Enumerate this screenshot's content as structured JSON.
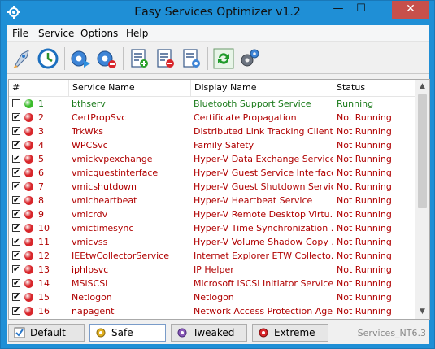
{
  "window": {
    "title": "Easy Services Optimizer v1.2",
    "minimize": "—",
    "maximize": "☐",
    "close": "✕"
  },
  "menu": [
    "File",
    "Service",
    "Options",
    "Help"
  ],
  "toolbar": [
    "rocket-icon",
    "restore-icon",
    "play-service-icon",
    "stop-service-icon",
    "doc-add-icon",
    "doc-remove-icon",
    "doc-settings-icon",
    "refresh-icon",
    "gears-icon"
  ],
  "columns": {
    "num": "#",
    "service": "Service Name",
    "display": "Display Name",
    "status": "Status"
  },
  "colors": {
    "running": "#1a7a1a",
    "stopped": "#b00000",
    "green_dot": "#3cbc2c",
    "red_dot": "#d8262b"
  },
  "rows": [
    {
      "checked": false,
      "state": "green",
      "num": "1",
      "service": "bthserv",
      "display": "Bluetooth Support Service",
      "status": "Running"
    },
    {
      "checked": true,
      "state": "red",
      "num": "2",
      "service": "CertPropSvc",
      "display": "Certificate Propagation",
      "status": "Not Running"
    },
    {
      "checked": true,
      "state": "red",
      "num": "3",
      "service": "TrkWks",
      "display": "Distributed Link Tracking Client",
      "status": "Not Running"
    },
    {
      "checked": true,
      "state": "red",
      "num": "4",
      "service": "WPCSvc",
      "display": "Family Safety",
      "status": "Not Running"
    },
    {
      "checked": true,
      "state": "red",
      "num": "5",
      "service": "vmickvpexchange",
      "display": "Hyper-V Data Exchange Service",
      "status": "Not Running"
    },
    {
      "checked": true,
      "state": "red",
      "num": "6",
      "service": "vmicguestinterface",
      "display": "Hyper-V Guest Service Interface",
      "status": "Not Running"
    },
    {
      "checked": true,
      "state": "red",
      "num": "7",
      "service": "vmicshutdown",
      "display": "Hyper-V Guest Shutdown Service",
      "status": "Not Running"
    },
    {
      "checked": true,
      "state": "red",
      "num": "8",
      "service": "vmicheartbeat",
      "display": "Hyper-V Heartbeat Service",
      "status": "Not Running"
    },
    {
      "checked": true,
      "state": "red",
      "num": "9",
      "service": "vmicrdv",
      "display": "Hyper-V Remote Desktop Virtu...",
      "status": "Not Running"
    },
    {
      "checked": true,
      "state": "red",
      "num": "10",
      "service": "vmictimesync",
      "display": "Hyper-V Time Synchronization ...",
      "status": "Not Running"
    },
    {
      "checked": true,
      "state": "red",
      "num": "11",
      "service": "vmicvss",
      "display": "Hyper-V Volume Shadow Copy ...",
      "status": "Not Running"
    },
    {
      "checked": true,
      "state": "red",
      "num": "12",
      "service": "IEEtwCollectorService",
      "display": "Internet Explorer ETW Collecto...",
      "status": "Not Running"
    },
    {
      "checked": true,
      "state": "red",
      "num": "13",
      "service": "iphlpsvc",
      "display": "IP Helper",
      "status": "Not Running"
    },
    {
      "checked": true,
      "state": "red",
      "num": "14",
      "service": "MSiSCSI",
      "display": "Microsoft iSCSI Initiator Service",
      "status": "Not Running"
    },
    {
      "checked": true,
      "state": "red",
      "num": "15",
      "service": "Netlogon",
      "display": "Netlogon",
      "status": "Not Running"
    },
    {
      "checked": true,
      "state": "red",
      "num": "16",
      "service": "napagent",
      "display": "Network Access Protection Agent",
      "status": "Not Running"
    }
  ],
  "presets": [
    {
      "label": "Default",
      "icon": "checkmark-icon",
      "active": false
    },
    {
      "label": "Safe",
      "icon": "safe-gear-icon",
      "active": true
    },
    {
      "label": "Tweaked",
      "icon": "tweaked-gear-icon",
      "active": false
    },
    {
      "label": "Extreme",
      "icon": "extreme-gear-icon",
      "active": false
    }
  ],
  "status_bar": "Services_NT6.3"
}
